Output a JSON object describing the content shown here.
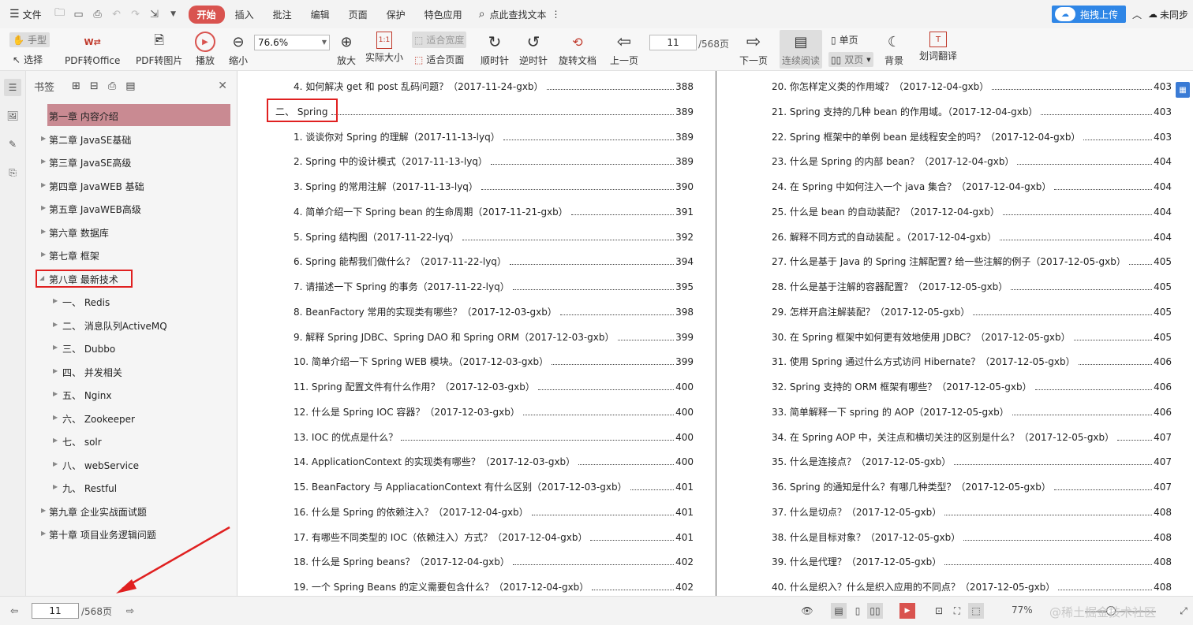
{
  "menubar": {
    "file_label": "文件",
    "tabs": [
      "开始",
      "插入",
      "批注",
      "编辑",
      "页面",
      "保护",
      "特色应用"
    ],
    "search_label": "点此查找文本",
    "upload_label": "拖拽上传",
    "sync_label": "未同步"
  },
  "toolbar": {
    "hand_label": "手型",
    "select_label": "选择",
    "pdf_to_office": "PDF转Office",
    "pdf_to_image": "PDF转图片",
    "play": "播放",
    "zoom_out": "缩小",
    "zoom_value": "76.6%",
    "zoom_in": "放大",
    "actual_size": "实际大小",
    "fit_width": "适合宽度",
    "fit_page": "适合页面",
    "rotate_cw": "顺时针",
    "rotate_ccw": "逆时针",
    "rotate_doc": "旋转文档",
    "prev_page": "上一页",
    "current_page": "11",
    "total_pages": "/568页",
    "next_page": "下一页",
    "continuous": "连续阅读",
    "single": "单页",
    "double": "双页",
    "background": "背景",
    "translate": "划词翻译"
  },
  "bookmarks": {
    "title": "书签",
    "items": [
      {
        "label": "第一章  内容介绍"
      },
      {
        "label": "第二章  JavaSE基础"
      },
      {
        "label": "第三章  JavaSE高级"
      },
      {
        "label": "第四章  JavaWEB 基础"
      },
      {
        "label": "第五章  JavaWEB高级"
      },
      {
        "label": "第六章  数据库"
      },
      {
        "label": "第七章  框架"
      },
      {
        "label": "第八章  最新技术"
      },
      {
        "label": "一、 Redis"
      },
      {
        "label": "二、 消息队列ActiveMQ"
      },
      {
        "label": "三、 Dubbo"
      },
      {
        "label": "四、 并发相关"
      },
      {
        "label": "五、 Nginx"
      },
      {
        "label": "六、 Zookeeper"
      },
      {
        "label": "七、 solr"
      },
      {
        "label": "八、 webService"
      },
      {
        "label": "九、 Restful"
      },
      {
        "label": "第九章  企业实战面试题"
      },
      {
        "label": "第十章  项目业务逻辑问题"
      }
    ]
  },
  "toc_left": [
    {
      "text": "4.  如何解决 get 和 post 乱码问题？（2017-11-24-gxb）",
      "page": "388"
    },
    {
      "text": "二、 Spring",
      "page": "389"
    },
    {
      "text": "1.  谈谈你对 Spring 的理解（2017-11-13-lyq）",
      "page": "389"
    },
    {
      "text": "2. Spring 中的设计模式（2017-11-13-lyq）",
      "page": "389"
    },
    {
      "text": "3. Spring 的常用注解（2017-11-13-lyq）",
      "page": "390"
    },
    {
      "text": "4.  简单介绍一下 Spring bean 的生命周期（2017-11-21-gxb）",
      "page": "391"
    },
    {
      "text": "5. Spring 结构图（2017-11-22-lyq）",
      "page": "392"
    },
    {
      "text": "6. Spring 能帮我们做什么？（2017-11-22-lyq）",
      "page": "394"
    },
    {
      "text": "7.  请描述一下 Spring 的事务（2017-11-22-lyq）",
      "page": "395"
    },
    {
      "text": "8. BeanFactory 常用的实现类有哪些？（2017-12-03-gxb）",
      "page": "398"
    },
    {
      "text": "9.  解释 Spring JDBC、Spring DAO 和 Spring ORM（2017-12-03-gxb）",
      "page": "399"
    },
    {
      "text": "10.  简单介绍一下 Spring WEB 模块。（2017-12-03-gxb）",
      "page": "399"
    },
    {
      "text": "11. Spring 配置文件有什么作用？（2017-12-03-gxb）",
      "page": "400"
    },
    {
      "text": "12.  什么是 Spring IOC 容器？（2017-12-03-gxb）",
      "page": "400"
    },
    {
      "text": "13. IOC 的优点是什么？",
      "page": "400"
    },
    {
      "text": "14. ApplicationContext 的实现类有哪些？（2017-12-03-gxb）",
      "page": "400"
    },
    {
      "text": "15. BeanFactory 与 AppliacationContext 有什么区别（2017-12-03-gxb）",
      "page": "401"
    },
    {
      "text": "16.  什么是 Spring 的依赖注入？（2017-12-04-gxb）",
      "page": "401"
    },
    {
      "text": "17.  有哪些不同类型的 IOC（依赖注入）方式？（2017-12-04-gxb）",
      "page": "401"
    },
    {
      "text": "18.  什么是 Spring beans？（2017-12-04-gxb）",
      "page": "402"
    },
    {
      "text": "19.  一个 Spring Beans 的定义需要包含什么？（2017-12-04-gxb）",
      "page": "402"
    }
  ],
  "toc_right": [
    {
      "text": "20.  你怎样定义类的作用域？（2017-12-04-gxb）",
      "page": "403"
    },
    {
      "text": "21. Spring 支持的几种 bean 的作用域。（2017-12-04-gxb）",
      "page": "403"
    },
    {
      "text": "22. Spring 框架中的单例 bean 是线程安全的吗？（2017-12-04-gxb）",
      "page": "403"
    },
    {
      "text": "23.  什么是 Spring 的内部 bean？（2017-12-04-gxb）",
      "page": "404"
    },
    {
      "text": "24.  在 Spring 中如何注入一个 java 集合？（2017-12-04-gxb）",
      "page": "404"
    },
    {
      "text": "25.  什么是 bean 的自动装配？（2017-12-04-gxb）",
      "page": "404"
    },
    {
      "text": "26.  解释不同方式的自动装配 。（2017-12-04-gxb）",
      "page": "404"
    },
    {
      "text": "27.  什么是基于 Java 的 Spring 注解配置? 给一些注解的例子（2017-12-05-gxb）",
      "page": "405"
    },
    {
      "text": "28.  什么是基于注解的容器配置？（2017-12-05-gxb）",
      "page": "405"
    },
    {
      "text": "29.  怎样开启注解装配？（2017-12-05-gxb）",
      "page": "405"
    },
    {
      "text": "30.  在 Spring 框架中如何更有效地使用 JDBC？（2017-12-05-gxb）",
      "page": "405"
    },
    {
      "text": "31.  使用 Spring 通过什么方式访问 Hibernate？（2017-12-05-gxb）",
      "page": "406"
    },
    {
      "text": "32. Spring 支持的 ORM 框架有哪些？（2017-12-05-gxb）",
      "page": "406"
    },
    {
      "text": "33.  简单解释一下 spring 的 AOP（2017-12-05-gxb）",
      "page": "406"
    },
    {
      "text": "34.  在 Spring AOP 中，关注点和横切关注的区别是什么？（2017-12-05-gxb）",
      "page": "407"
    },
    {
      "text": "35.  什么是连接点？（2017-12-05-gxb）",
      "page": "407"
    },
    {
      "text": "36. Spring 的通知是什么？有哪几种类型？（2017-12-05-gxb）",
      "page": "407"
    },
    {
      "text": "37.  什么是切点？（2017-12-05-gxb）",
      "page": "408"
    },
    {
      "text": "38.  什么是目标对象？（2017-12-05-gxb）",
      "page": "408"
    },
    {
      "text": "39.  什么是代理？（2017-12-05-gxb）",
      "page": "408"
    },
    {
      "text": "40.  什么是织入？什么是织入应用的不同点？（2017-12-05-gxb）",
      "page": "408"
    }
  ],
  "statusbar": {
    "current_page": "11",
    "total_pages": "/568页",
    "zoom_percent": "77%",
    "watermark": "@稀土掘金技术社区"
  },
  "colors": {
    "accent": "#d9534f",
    "highlight": "#c98a92",
    "annotation": "#e02020",
    "upload": "#2f86e6"
  }
}
